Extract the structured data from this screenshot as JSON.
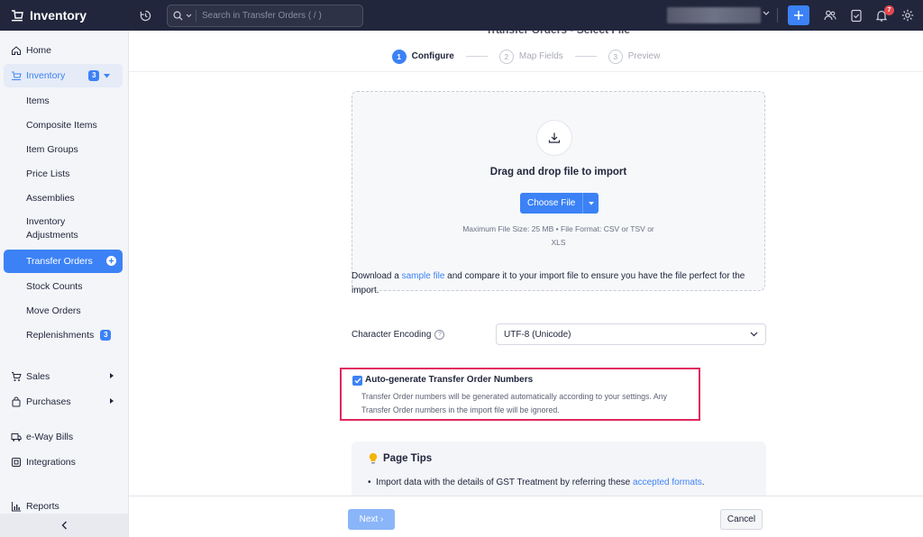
{
  "app": {
    "title": "Inventory"
  },
  "search": {
    "placeholder": "Search in Transfer Orders ( / )"
  },
  "notifications": {
    "count": "7"
  },
  "sidebar": {
    "home": "Home",
    "inventory": {
      "label": "Inventory",
      "count": "3"
    },
    "items": [
      {
        "label": "Items"
      },
      {
        "label": "Composite Items"
      },
      {
        "label": "Item Groups"
      },
      {
        "label": "Price Lists"
      },
      {
        "label": "Assemblies"
      },
      {
        "label": "Inventory",
        "label2": "Adjustments"
      },
      {
        "label": "Transfer Orders"
      },
      {
        "label": "Stock Counts"
      },
      {
        "label": "Move Orders"
      },
      {
        "label": "Replenishments",
        "count": "3"
      }
    ],
    "sales": "Sales",
    "purchases": "Purchases",
    "eway": "e-Way Bills",
    "integrations": "Integrations",
    "reports": "Reports"
  },
  "page": {
    "title": "Transfer Orders - Select File"
  },
  "steps": [
    {
      "num": "1",
      "label": "Configure"
    },
    {
      "num": "2",
      "label": "Map Fields"
    },
    {
      "num": "3",
      "label": "Preview"
    }
  ],
  "dropzone": {
    "title": "Drag and drop file to import",
    "choose_label": "Choose File",
    "note_line1": "Maximum File Size: 25 MB  •  File Format: CSV or TSV or",
    "note_line2": "XLS"
  },
  "sample": {
    "prefix": "Download a ",
    "link": "sample file",
    "suffix": " and compare it to your import file to ensure you have the file perfect for the import."
  },
  "encoding": {
    "label": "Character Encoding",
    "value": "UTF-8 (Unicode)"
  },
  "autogen": {
    "title": "Auto-generate Transfer Order Numbers",
    "desc": "Transfer Order numbers will be generated automatically according to your settings. Any Transfer Order numbers in the import file will be ignored.",
    "checked": true
  },
  "tips": {
    "title": "Page Tips",
    "item_prefix": "Import data with the details of GST Treatment by referring these ",
    "item_link": "accepted formats",
    "item_suffix": "."
  },
  "footer": {
    "next": "Next ›",
    "cancel": "Cancel"
  },
  "colors": {
    "primary": "#3c82f6",
    "topbar": "#21263c",
    "highlight": "#e0275d"
  }
}
